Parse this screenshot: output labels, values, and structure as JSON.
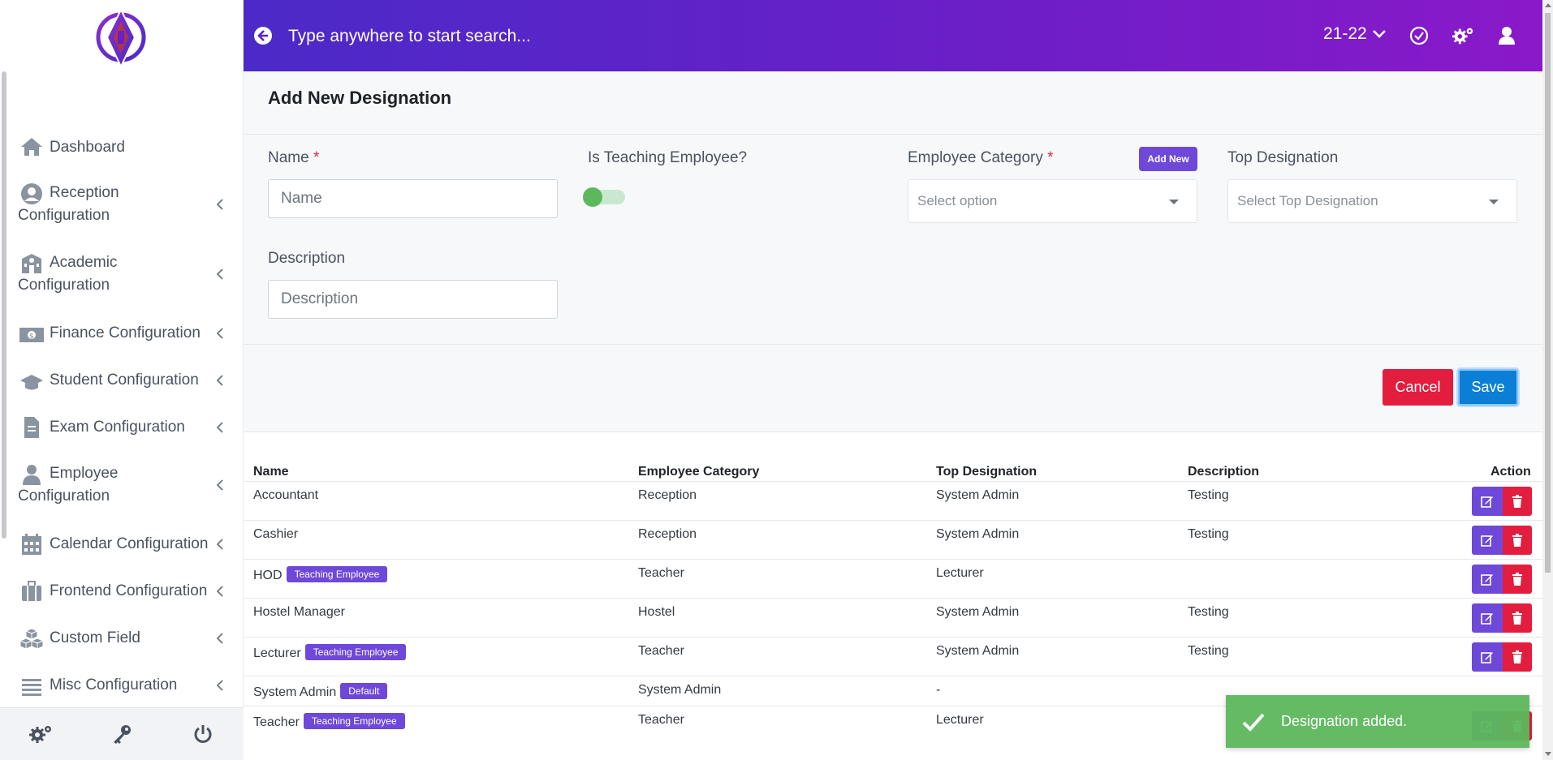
{
  "topbar": {
    "search_placeholder": "Type anywhere to start search...",
    "session": "21-22"
  },
  "sidebar": {
    "items": [
      {
        "label": "Dashboard",
        "icon": "home-icon"
      },
      {
        "label": "Reception Configuration",
        "icon": "user-circle-icon"
      },
      {
        "label": "Academic Configuration",
        "icon": "school-icon"
      },
      {
        "label": "Finance Configuration",
        "icon": "money-icon"
      },
      {
        "label": "Student Configuration",
        "icon": "graduation-cap-icon"
      },
      {
        "label": "Exam Configuration",
        "icon": "file-icon"
      },
      {
        "label": "Employee Configuration",
        "icon": "employee-icon"
      },
      {
        "label": "Calendar Configuration",
        "icon": "calendar-icon"
      },
      {
        "label": "Frontend Configuration",
        "icon": "briefcase-icon"
      },
      {
        "label": "Custom Field",
        "icon": "cubes-icon"
      },
      {
        "label": "Misc Configuration",
        "icon": "list-icon"
      }
    ]
  },
  "form": {
    "title": "Add New Designation",
    "name_label": "Name",
    "name_placeholder": "Name",
    "required_mark": "*",
    "teaching_label": "Is Teaching Employee?",
    "category_label": "Employee Category",
    "add_new": "Add New",
    "category_placeholder": "Select option",
    "top_label": "Top Designation",
    "top_placeholder": "Select Top Designation",
    "description_label": "Description",
    "description_placeholder": "Description",
    "cancel": "Cancel",
    "save": "Save"
  },
  "table": {
    "headers": {
      "name": "Name",
      "category": "Employee Category",
      "top": "Top Designation",
      "description": "Description",
      "action": "Action"
    },
    "rows": [
      {
        "name": "Accountant",
        "badge": "",
        "category": "Reception",
        "top": "System Admin",
        "description": "Testing"
      },
      {
        "name": "Cashier",
        "badge": "",
        "category": "Reception",
        "top": "System Admin",
        "description": "Testing"
      },
      {
        "name": "HOD",
        "badge": "Teaching Employee",
        "category": "Teacher",
        "top": "Lecturer",
        "description": ""
      },
      {
        "name": "Hostel Manager",
        "badge": "",
        "category": "Hostel",
        "top": "System Admin",
        "description": "Testing"
      },
      {
        "name": "Lecturer",
        "badge": "Teaching Employee",
        "category": "Teacher",
        "top": "System Admin",
        "description": "Testing"
      },
      {
        "name": "System Admin",
        "badge": "Default",
        "category": "System Admin",
        "top": "-",
        "description": ""
      },
      {
        "name": "Teacher",
        "badge": "Teaching Employee",
        "category": "Teacher",
        "top": "Lecturer",
        "description": ""
      }
    ]
  },
  "toast": {
    "message": "Designation added."
  },
  "colors": {
    "accent": "#6e48d8",
    "danger": "#e21d3e",
    "primary": "#0b7fd6",
    "success": "#5cb85c"
  }
}
